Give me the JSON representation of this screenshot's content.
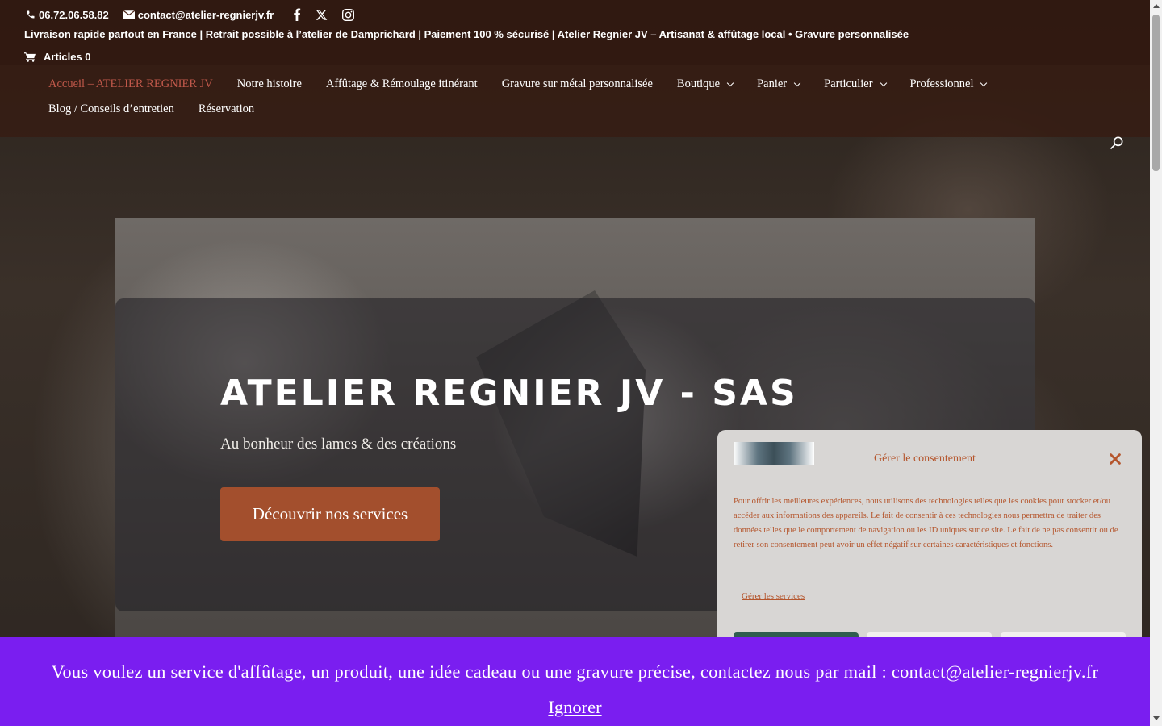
{
  "topbar": {
    "phone": "06.72.06.58.82",
    "email": "contact@atelier-regnierjv.fr",
    "social_icons": [
      "facebook-icon",
      "x-icon",
      "instagram-icon"
    ]
  },
  "promo_line": " Livraison rapide partout en France  |    Retrait possible à l’atelier de Damprichard  |    Paiement 100 % sécurisé  |    Atelier Regnier JV – Artisanat & affûtage local  • Gravure personnalisée ",
  "cart": {
    "label": "Articles 0"
  },
  "nav": {
    "items": [
      {
        "label": "Accueil – ATELIER REGNIER JV",
        "active": true,
        "dropdown": false
      },
      {
        "label": "Notre histoire",
        "dropdown": false
      },
      {
        "label": "Affûtage & Rémoulage itinérant",
        "dropdown": false
      },
      {
        "label": "Gravure sur métal personnalisée",
        "dropdown": false
      },
      {
        "label": "Boutique",
        "dropdown": true
      },
      {
        "label": "Panier",
        "dropdown": true
      },
      {
        "label": "Particulier",
        "dropdown": true
      },
      {
        "label": "Professionnel",
        "dropdown": true
      },
      {
        "label": "Blog / Conseils d’entretien",
        "dropdown": false
      },
      {
        "label": "Réservation",
        "dropdown": false
      }
    ]
  },
  "hero": {
    "title": "ATELIER REGNIER JV - SAS",
    "subtitle": "Au bonheur des lames & des créations",
    "cta": "Découvrir nos services"
  },
  "cookie": {
    "title": "Gérer le consentement",
    "text": "Pour offrir les meilleures expériences, nous utilisons des technologies telles que les cookies pour stocker et/ou accéder aux informations des appareils. Le fait de consentir à ces technologies nous permettra de traiter des données telles que le comportement de navigation ou les ID uniques sur ce site. Le fait de ne pas consentir ou de retirer son consentement peut avoir un effet négatif sur certaines caractéristiques et fonctions.",
    "manage_services": "Gérer les services"
  },
  "banner": {
    "message": "Vous voulez un service d'affûtage, un produit, une idée cadeau ou une gravure précise, contactez nous par mail : contact@atelier-regnierjv.fr",
    "dismiss": "Ignorer"
  },
  "colors": {
    "accent_brown": "#a34f2d",
    "active_nav": "#c0584a",
    "banner_purple": "#7a1ef0",
    "cookie_text": "#b5562d",
    "cookie_accept": "#2f5d4f"
  }
}
